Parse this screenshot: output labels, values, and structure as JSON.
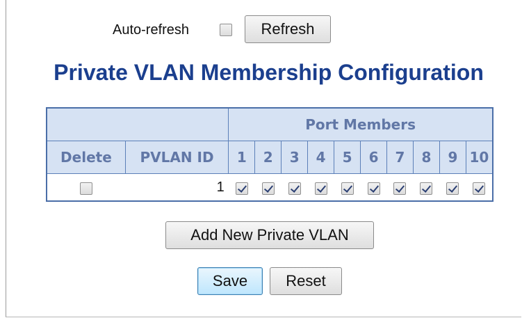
{
  "toolbar": {
    "auto_refresh_label": "Auto-refresh",
    "auto_refresh_checked": false,
    "refresh_label": "Refresh"
  },
  "page": {
    "title": "Private VLAN Membership Configuration"
  },
  "table": {
    "group_header": "Port Members",
    "columns": {
      "delete": "Delete",
      "pvlan_id": "PVLAN ID"
    },
    "ports": [
      "1",
      "2",
      "3",
      "4",
      "5",
      "6",
      "7",
      "8",
      "9",
      "10"
    ],
    "rows": [
      {
        "delete": false,
        "pvlan_id": "1",
        "members": [
          true,
          true,
          true,
          true,
          true,
          true,
          true,
          true,
          true,
          true
        ]
      }
    ]
  },
  "actions": {
    "add_label": "Add New Private VLAN",
    "save_label": "Save",
    "reset_label": "Reset"
  },
  "colors": {
    "title": "#1b3f8e",
    "header_bg": "#d6e2f3",
    "header_text": "#6177a6",
    "border": "#4a6ea8"
  }
}
